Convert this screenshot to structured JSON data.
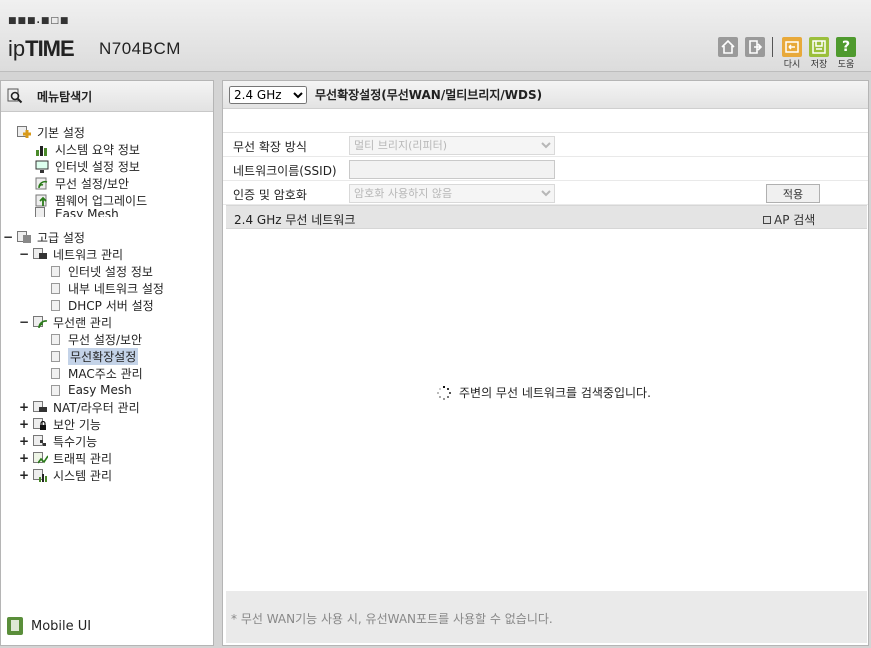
{
  "header": {
    "logo_dots": "■■■.■□■",
    "logo_prefix": "ip",
    "logo_bold": "TIME",
    "model": "N704BCM",
    "buttons": [
      {
        "icon": "home-icon"
      },
      {
        "icon": "logout-icon"
      },
      {
        "icon": "redo-icon",
        "label": "다시"
      },
      {
        "icon": "save-icon",
        "label": "저장"
      },
      {
        "icon": "help-icon",
        "label": "도움"
      }
    ]
  },
  "sidebar": {
    "title": "메뉴탐색기",
    "basic": {
      "label": "기본 설정",
      "items": [
        "시스템 요약 정보",
        "인터넷 설정 정보",
        "무선 설정/보안",
        "펌웨어 업그레이드",
        "Easy Mesh"
      ]
    },
    "advanced": {
      "toggle": "−",
      "label": "고급 설정",
      "network": {
        "toggle": "−",
        "label": "네트워크 관리",
        "items": [
          "인터넷 설정 정보",
          "내부 네트워크 설정",
          "DHCP 서버 설정"
        ]
      },
      "wireless": {
        "toggle": "−",
        "label": "무선랜 관리",
        "items": [
          "무선 설정/보안",
          "무선확장설정",
          "MAC주소 관리",
          "Easy Mesh"
        ],
        "selected": "무선확장설정"
      },
      "collapsed": [
        {
          "toggle": "+",
          "label": "NAT/라우터 관리"
        },
        {
          "toggle": "+",
          "label": "보안 기능"
        },
        {
          "toggle": "+",
          "label": "특수기능"
        },
        {
          "toggle": "+",
          "label": "트래픽 관리"
        },
        {
          "toggle": "+",
          "label": "시스템 관리"
        }
      ]
    },
    "mobile": "Mobile UI"
  },
  "main": {
    "band_select": "2.4 GHz",
    "title": "무선확장설정(무선WAN/멀티브리지/WDS)",
    "form": {
      "mode_label": "무선 확장 방식",
      "mode_value": "멀티 브리지(리피터)",
      "ssid_label": "네트워크이름(SSID)",
      "ssid_value": "",
      "auth_label": "인증 및 암호화",
      "auth_value": "암호화 사용하지 않음",
      "apply": "적용"
    },
    "network_bar": {
      "title": "2.4 GHz 무선 네트워크",
      "ap_search": "AP 검색"
    },
    "searching": "주변의 무선 네트워크를 검색중입니다.",
    "footer_note": "* 무선 WAN기능 사용 시, 유선WAN포트를 사용할 수 없습니다."
  }
}
